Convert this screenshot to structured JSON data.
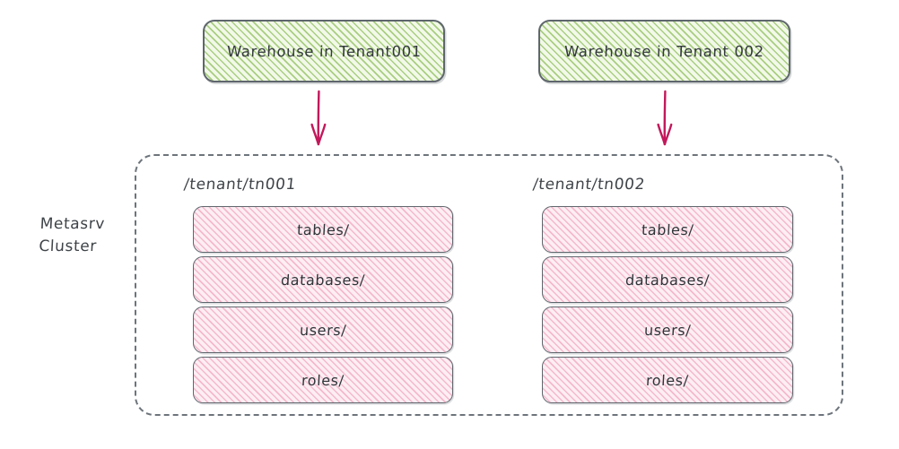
{
  "diagram": {
    "title_text": "",
    "colors": {
      "green_fill": "#f2f9e8",
      "green_hatch": "#7cb342",
      "pink_fill": "#fdeef3",
      "pink_hatch": "#e96e96",
      "stroke": "#5f666d",
      "arrow": "#c2185b",
      "text": "#3f4449"
    }
  },
  "warehouses": [
    {
      "label": "Warehouse in Tenant001"
    },
    {
      "label": "Warehouse in Tenant 002"
    }
  ],
  "arrows": [
    {
      "name": "arrow-warehouse-1-to-tenant-1"
    },
    {
      "name": "arrow-warehouse-2-to-tenant-2"
    }
  ],
  "cluster": {
    "label": "Metasrv\nCluster",
    "tenants": [
      {
        "path": "/tenant/tn001",
        "resources": [
          {
            "label": "tables/"
          },
          {
            "label": "databases/"
          },
          {
            "label": "users/"
          },
          {
            "label": "roles/"
          }
        ]
      },
      {
        "path": "/tenant/tn002",
        "resources": [
          {
            "label": "tables/"
          },
          {
            "label": "databases/"
          },
          {
            "label": "users/"
          },
          {
            "label": "roles/"
          }
        ]
      }
    ]
  }
}
